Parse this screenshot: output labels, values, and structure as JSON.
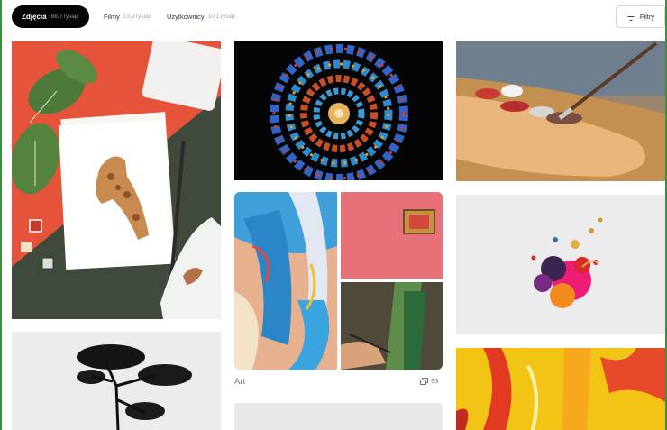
{
  "tabs": {
    "photos": {
      "label": "Zdjęcia",
      "count": "88,7Tysiąc"
    },
    "films": {
      "label": "Filmy",
      "count": "13,9Tysiąc"
    },
    "users": {
      "label": "Użytkownicy",
      "count": "10,1Tysiąc"
    }
  },
  "filter": {
    "label": "Filtry",
    "icon": "filter-icon"
  },
  "collection": {
    "title": "Art",
    "count": "93",
    "icon": "stack-icon"
  },
  "colors": {
    "accent": "#050505",
    "frame": "#3c8f3c",
    "muted": "#777777"
  }
}
